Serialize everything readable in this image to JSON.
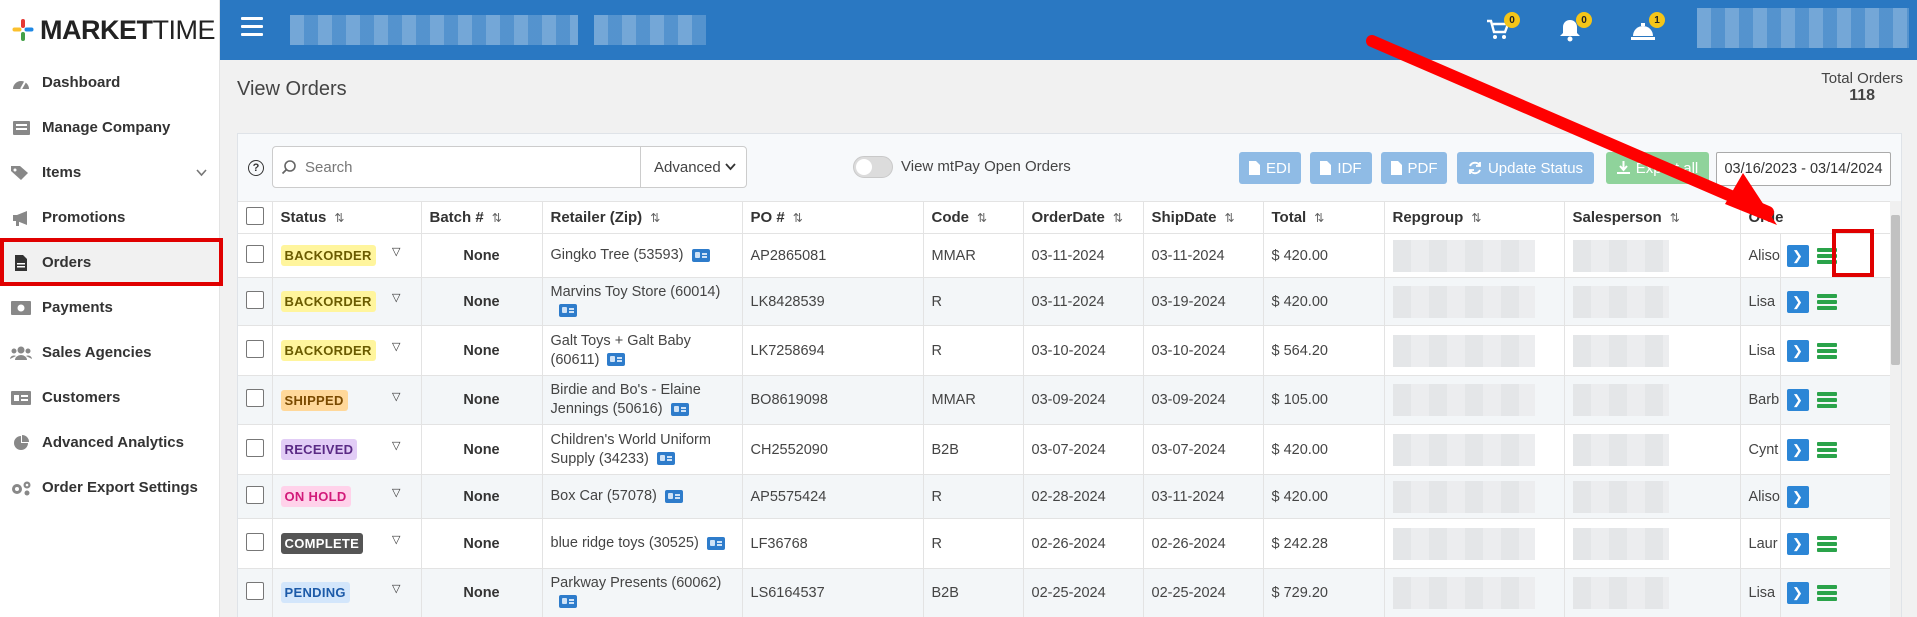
{
  "brand": {
    "logo_bold": "MARKET",
    "logo_light": "TIME"
  },
  "sidebar": {
    "items": [
      {
        "label": "Dashboard",
        "icon": "dashboard-icon"
      },
      {
        "label": "Manage Company",
        "icon": "list-icon"
      },
      {
        "label": "Items",
        "icon": "tags-icon",
        "has_submenu": true
      },
      {
        "label": "Promotions",
        "icon": "bullhorn-icon"
      },
      {
        "label": "Orders",
        "icon": "file-icon",
        "active": true
      },
      {
        "label": "Payments",
        "icon": "money-icon"
      },
      {
        "label": "Sales Agencies",
        "icon": "users-icon"
      },
      {
        "label": "Customers",
        "icon": "id-card-icon"
      },
      {
        "label": "Advanced Analytics",
        "icon": "pie-chart-icon"
      },
      {
        "label": "Order Export Settings",
        "icon": "gears-icon"
      }
    ]
  },
  "topbar": {
    "cart_count": "0",
    "notifications_count": "0",
    "alerts_count": "1"
  },
  "page": {
    "title": "View Orders",
    "total_label": "Total Orders",
    "total_value": "118"
  },
  "toolbar": {
    "search_placeholder": "Search",
    "advanced_label": "Advanced",
    "toggle_label": "View mtPay Open Orders",
    "edi_label": "EDI",
    "idf_label": "IDF",
    "pdf_label": "PDF",
    "update_status_label": "Update Status",
    "export_all_label": "Export all",
    "date_range": "03/16/2023 - 03/14/2024"
  },
  "table": {
    "columns": [
      "Status",
      "Batch #",
      "Retailer (Zip)",
      "PO #",
      "Code",
      "OrderDate",
      "ShipDate",
      "Total",
      "Repgroup",
      "Salesperson",
      "Orde"
    ],
    "rows": [
      {
        "status": "BACKORDER",
        "status_class": "back",
        "batch": "None",
        "retailer": "Gingko Tree (53593)",
        "po": "AP2865081",
        "code": "MMAR",
        "order_date": "03-11-2024",
        "ship_date": "03-11-2024",
        "total": "$ 420.00",
        "orderer": "Aliso",
        "has_green": true
      },
      {
        "status": "BACKORDER",
        "status_class": "back",
        "batch": "None",
        "retailer": "Marvins Toy Store (60014)",
        "po": "LK8428539",
        "code": "R",
        "order_date": "03-11-2024",
        "ship_date": "03-19-2024",
        "total": "$ 420.00",
        "orderer": "Lisa",
        "has_green": true
      },
      {
        "status": "BACKORDER",
        "status_class": "back",
        "batch": "None",
        "retailer": "Galt Toys + Galt Baby (60611)",
        "po": "LK7258694",
        "code": "R",
        "order_date": "03-10-2024",
        "ship_date": "03-10-2024",
        "total": "$ 564.20",
        "orderer": "Lisa",
        "has_green": true
      },
      {
        "status": "SHIPPED",
        "status_class": "ship",
        "batch": "None",
        "retailer": "Birdie and Bo's - Elaine Jennings (50616)",
        "po": "BO8619098",
        "code": "MMAR",
        "order_date": "03-09-2024",
        "ship_date": "03-09-2024",
        "total": "$ 105.00",
        "orderer": "Barb",
        "has_green": true
      },
      {
        "status": "RECEIVED",
        "status_class": "recv",
        "batch": "None",
        "retailer": "Children's World Uniform Supply (34233)",
        "po": "CH2552090",
        "code": "B2B",
        "order_date": "03-07-2024",
        "ship_date": "03-07-2024",
        "total": "$ 420.00",
        "orderer": "Cynt",
        "has_green": true
      },
      {
        "status": "ON HOLD",
        "status_class": "hold",
        "batch": "None",
        "retailer": "Box Car (57078)",
        "po": "AP5575424",
        "code": "R",
        "order_date": "02-28-2024",
        "ship_date": "03-11-2024",
        "total": "$ 420.00",
        "orderer": "Aliso",
        "has_green": false
      },
      {
        "status": "COMPLETE",
        "status_class": "comp",
        "batch": "None",
        "retailer": "blue ridge toys (30525)",
        "po": "LF36768",
        "code": "R",
        "order_date": "02-26-2024",
        "ship_date": "02-26-2024",
        "total": "$ 242.28",
        "orderer": "Laur",
        "has_green": true
      },
      {
        "status": "PENDING",
        "status_class": "pend",
        "batch": "None",
        "retailer": "Parkway Presents (60062)",
        "po": "LS6164537",
        "code": "B2B",
        "order_date": "02-25-2024",
        "ship_date": "02-25-2024",
        "total": "$ 729.20",
        "orderer": "Lisa",
        "has_green": true
      }
    ]
  },
  "colors": {
    "topbar": "#2a78c2",
    "highlight": "#e00000",
    "action_blue": "#2c86d6",
    "action_green": "#2aa34a"
  }
}
